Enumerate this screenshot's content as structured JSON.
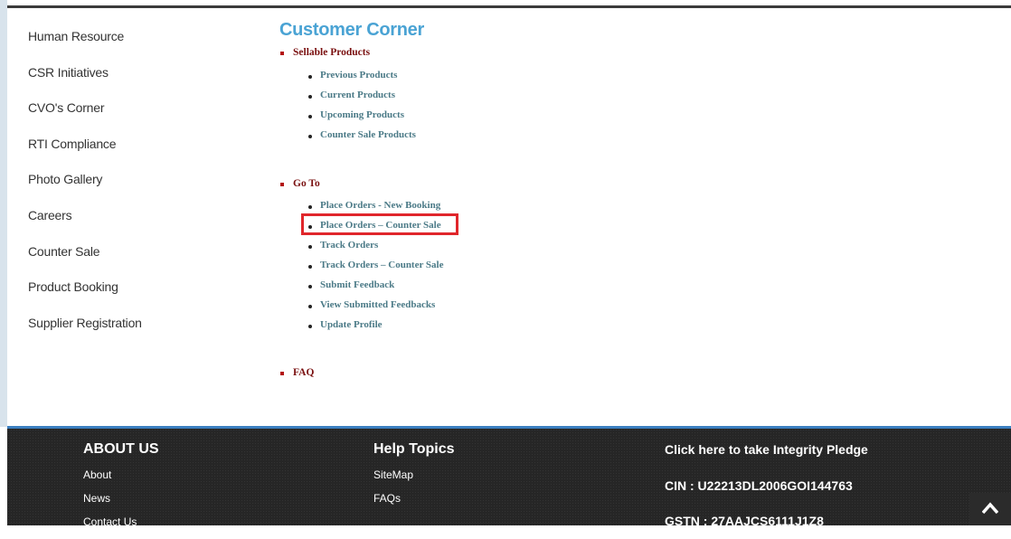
{
  "sidebar": {
    "items": [
      "Human Resource",
      "CSR Initiatives",
      "CVO's Corner",
      "RTI Compliance",
      "Photo Gallery",
      "Careers",
      "Counter Sale",
      "Product Booking",
      "Supplier Registration"
    ]
  },
  "main": {
    "title": "Customer Corner",
    "sections": [
      {
        "heading": "Sellable Products",
        "items": [
          "Previous Products",
          "Current Products",
          "Upcoming Products",
          "Counter Sale Products"
        ]
      },
      {
        "heading": "Go To",
        "items": [
          "Place Orders - New Booking",
          "Place Orders – Counter Sale",
          "Track Orders",
          "Track Orders – Counter Sale",
          "Submit Feedback",
          "View Submitted Feedbacks",
          "Update Profile"
        ]
      },
      {
        "heading": "FAQ",
        "items": []
      }
    ]
  },
  "footer": {
    "about": {
      "heading": "ABOUT US",
      "links": [
        "About",
        "News",
        "Contact Us"
      ]
    },
    "help": {
      "heading": "Help Topics",
      "links": [
        "SiteMap",
        "FAQs"
      ]
    },
    "info": {
      "pledge": "Click here to take Integrity Pledge",
      "cin": "CIN : U22213DL2006GOI144763",
      "gstn": "GSTN : 27AAJCS6111J1Z8"
    }
  },
  "colors": {
    "title": "#4aa3d4",
    "section_heading": "#7a1010",
    "link": "#4b7a87",
    "highlight": "#e0262b",
    "footer_bg": "#262626",
    "footer_accent": "#3b7fc0"
  },
  "icons": {
    "scroll_top": "chevron-up-icon"
  }
}
